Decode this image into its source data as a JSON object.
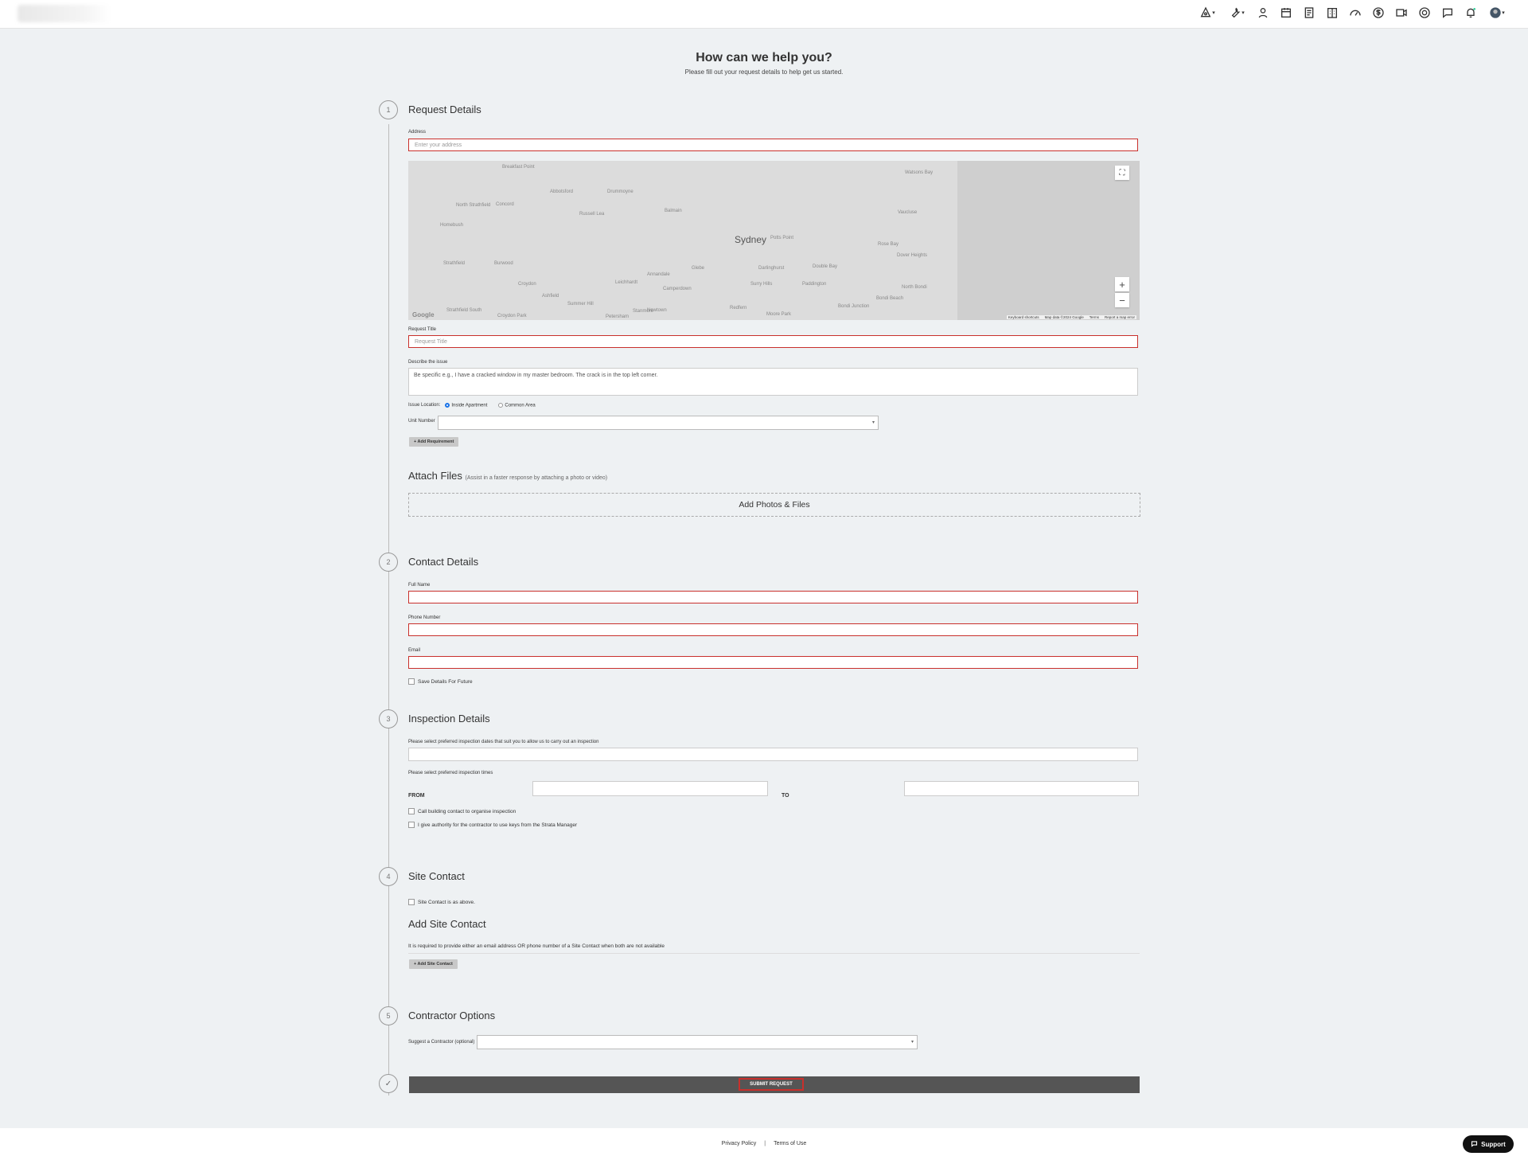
{
  "header": {
    "icons": [
      "tools-icon",
      "wrench-icon",
      "contractor-icon",
      "calendar-icon",
      "document-icon",
      "building-icon",
      "gauge-icon",
      "dollar-icon",
      "video-icon",
      "lifebuoy-icon",
      "chat-icon",
      "bell-icon",
      "profile-icon"
    ]
  },
  "page": {
    "title": "How can we help you?",
    "subtitle": "Please fill out your request details to help get us started."
  },
  "steps": {
    "s1": "1",
    "s2": "2",
    "s3": "3",
    "s4": "4",
    "s5": "5",
    "done": "✓"
  },
  "request": {
    "title": "Request Details",
    "address_label": "Address",
    "address_placeholder": "Enter your address",
    "request_title_label": "Request Title",
    "request_title_placeholder": "Request Title",
    "describe_label": "Describe the issue",
    "describe_placeholder": "Be specific e.g., I have a cracked window in my master bedroom. The crack is in the top left corner.",
    "issue_location_label": "Issue Location:",
    "option_inside": "Inside Apartment",
    "option_common": "Common Area",
    "unit_number_label": "Unit Number",
    "add_requirement": "+ Add Requirement"
  },
  "map": {
    "city": "Sydney",
    "labels": [
      "Breakfast Point",
      "Drummoyne",
      "Abbotsford",
      "North Strathfield",
      "Concord",
      "Russell Lea",
      "Homebush",
      "Balmain",
      "Strathfield",
      "Burwood",
      "Croydon",
      "Ashfield",
      "Leichhardt",
      "Glebe",
      "Annandale",
      "Camperdown",
      "Newtown",
      "Stanmore",
      "Petersham",
      "Summer Hill",
      "Croydon Park",
      "Strathfield South",
      "Redfern",
      "Surry Hills",
      "Paddington",
      "Darlinghurst",
      "Double Bay",
      "Rose Bay",
      "Vaucluse",
      "Watsons Bay",
      "Dover Heights",
      "North Bondi",
      "Bondi Beach",
      "Bondi Junction",
      "Moore Park",
      "Potts Point"
    ],
    "zoom_in": "+",
    "zoom_out": "−",
    "fullscreen": "⛶",
    "google": "Google",
    "attr_keyboard": "Keyboard shortcuts",
    "attr_mapdata": "Map data ©2024 Google",
    "attr_terms": "Terms",
    "attr_report": "Report a map error"
  },
  "attach": {
    "title": "Attach Files",
    "hint": "(Assist in a faster response by attaching a photo or video)",
    "drop_label": "Add Photos & Files"
  },
  "contact": {
    "title": "Contact Details",
    "full_name_label": "Full Name",
    "phone_label": "Phone Number",
    "email_label": "Email",
    "save_details": "Save Details For Future"
  },
  "inspection": {
    "title": "Inspection Details",
    "dates_label": "Please select preferred inspection dates that suit you to allow us to carry out an inspection",
    "times_label": "Please select preferred inspection times",
    "from": "FROM",
    "to": "TO",
    "call_contact": "Call building contact to organise inspection",
    "authority": "I give authority for the contractor to use keys from the Strata Manager"
  },
  "site": {
    "title": "Site Contact",
    "same_as_above": "Site Contact is as above.",
    "add_title": "Add Site Contact",
    "note": "It is required to provide either an email address OR phone number of a Site Contact when both are not available",
    "add_button": "+ Add Site Contact"
  },
  "contractor": {
    "title": "Contractor Options",
    "suggest_label": "Suggest a Contractor (optional)"
  },
  "submit": {
    "label": "SUBMIT REQUEST"
  },
  "footer": {
    "privacy": "Privacy Policy",
    "separator": "|",
    "terms": "Terms of Use",
    "support": "Support"
  },
  "colors": {
    "required_border": "#c9302c",
    "submit_bar": "#555555",
    "radio_active": "#1a73e8"
  }
}
